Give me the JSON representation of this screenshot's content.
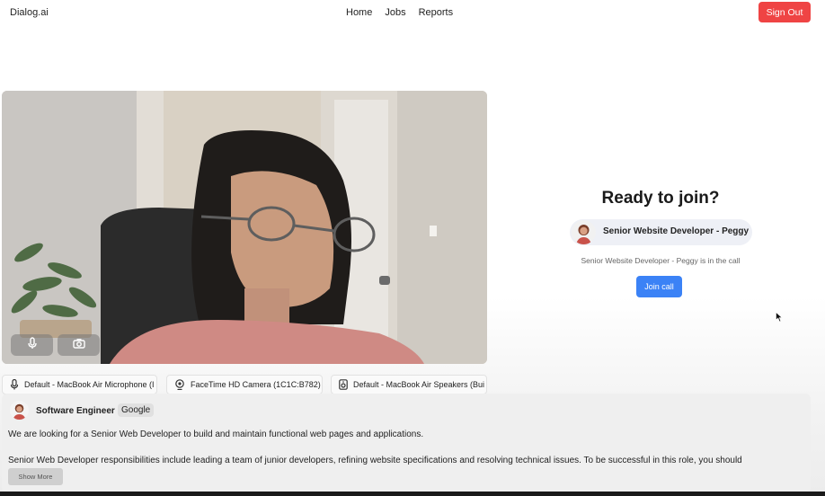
{
  "header": {
    "brand": "Dialog.ai",
    "nav": [
      "Home",
      "Jobs",
      "Reports"
    ],
    "sign_out": "Sign Out"
  },
  "video": {
    "mic_icon": "mic-icon",
    "camera_icon": "camera-icon"
  },
  "devices": {
    "microphone": "Default - MacBook Air Microphone (I",
    "camera": "FaceTime HD Camera (1C1C:B782)",
    "speakers": "Default - MacBook Air Speakers (Bui"
  },
  "join_panel": {
    "title": "Ready to join?",
    "participant": "Senior Website Developer - Peggy",
    "in_call_text": "Senior Website Developer - Peggy is in the call",
    "join_button": "Join call",
    "accent": "#3b82f6"
  },
  "job": {
    "title": "Software Engineer",
    "company": "Google",
    "description_1": "We are looking for a Senior Web Developer to build and maintain functional web pages and applications.",
    "description_2": "Senior Web Developer responsibilities include leading a team of junior developers, refining website specifications and resolving technical issues. To be successful in this role, you should",
    "show_more": "Show More"
  },
  "colors": {
    "sign_out": "#ef4444",
    "join": "#3b82f6"
  }
}
